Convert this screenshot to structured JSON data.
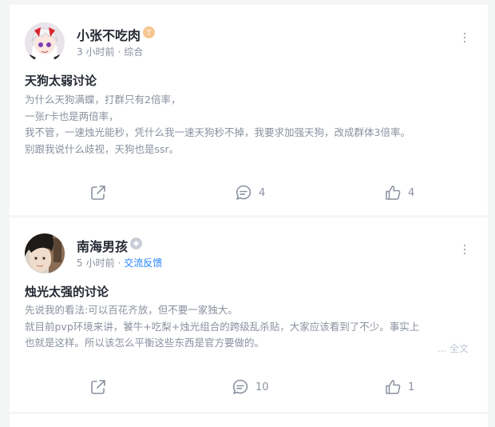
{
  "posts": [
    {
      "username": "小张不吃肉",
      "time": "3 小时前",
      "topic": "综合",
      "title": "天狗太弱讨论",
      "lines": [
        "为什么天狗满蝶，打群只有2倍率，",
        "一张r卡也是两倍率，",
        "我不管，一速烛光能秒，凭什么我一速天狗秒不掉，我要求加强天狗，改成群体3倍率。",
        "别跟我说什么歧视，天狗也是ssr。"
      ],
      "comments": "4",
      "likes": "4"
    },
    {
      "username": "南海男孩",
      "time": "5 小时前",
      "topic": "交流反馈",
      "title": "烛光太强的讨论",
      "lines": [
        "先说我的看法:可以百花齐放，但不要一家独大。",
        "就目前pvp环境来讲，饕牛+吃梨+烛光组合的跨级乱杀贴，大家应该看到了不少。事实上",
        "也就是这样。所以该怎么平衡这些东西是官方要做的。"
      ],
      "full_text_label": "... 全文",
      "comments": "10",
      "likes": "1"
    }
  ],
  "icons": {
    "share": "share-icon",
    "comment": "comment-icon",
    "like": "thumbs-up-icon",
    "more": "more-vertical-icon"
  },
  "colors": {
    "accent": "#1e80ff",
    "badge_gold": "#f6c690",
    "badge_gray": "#c9ced6"
  }
}
